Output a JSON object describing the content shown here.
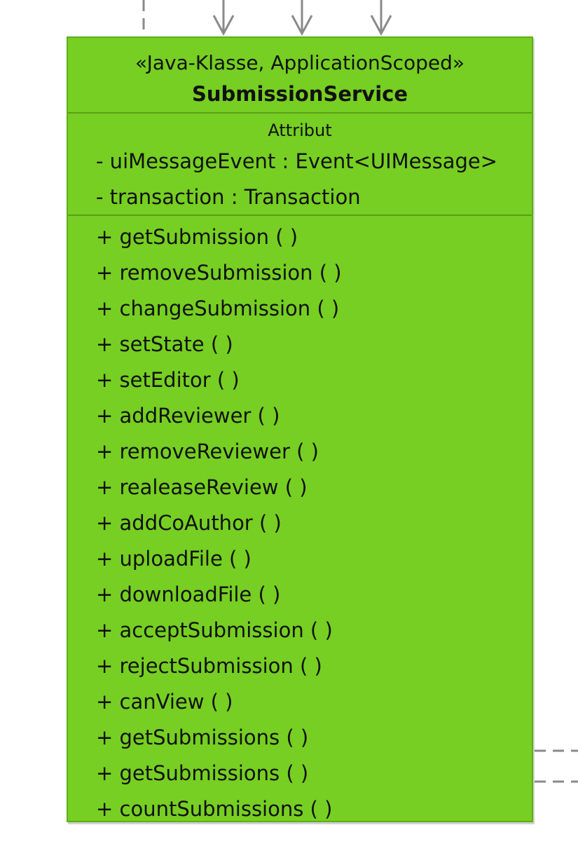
{
  "diagram": {
    "class": {
      "stereotype": "«Java-Klasse, ApplicationScoped»",
      "name": "SubmissionService",
      "background_color": "#76cf22",
      "border_color": "#5fae16"
    },
    "attributes": {
      "label": "Attribut",
      "items": [
        "- uiMessageEvent : Event<UIMessage>",
        "- transaction : Transaction"
      ]
    },
    "operations": {
      "items": [
        "+ getSubmission ( )",
        "+ removeSubmission ( )",
        "+ changeSubmission ( )",
        "+ setState ( )",
        "+ setEditor ( )",
        "+ addReviewer ( )",
        "+ removeReviewer ( )",
        "+ realeaseReview ( )",
        "+ addCoAuthor ( )",
        "+ uploadFile ( )",
        "+ downloadFile ( )",
        "+ acceptSubmission ( )",
        "+ rejectSubmission ( )",
        "+ canView ( )",
        "+ getSubmissions ( )",
        "+ getSubmissions ( )",
        "+ countSubmissions ( )"
      ]
    },
    "connector_color": "#8a8a8a"
  }
}
